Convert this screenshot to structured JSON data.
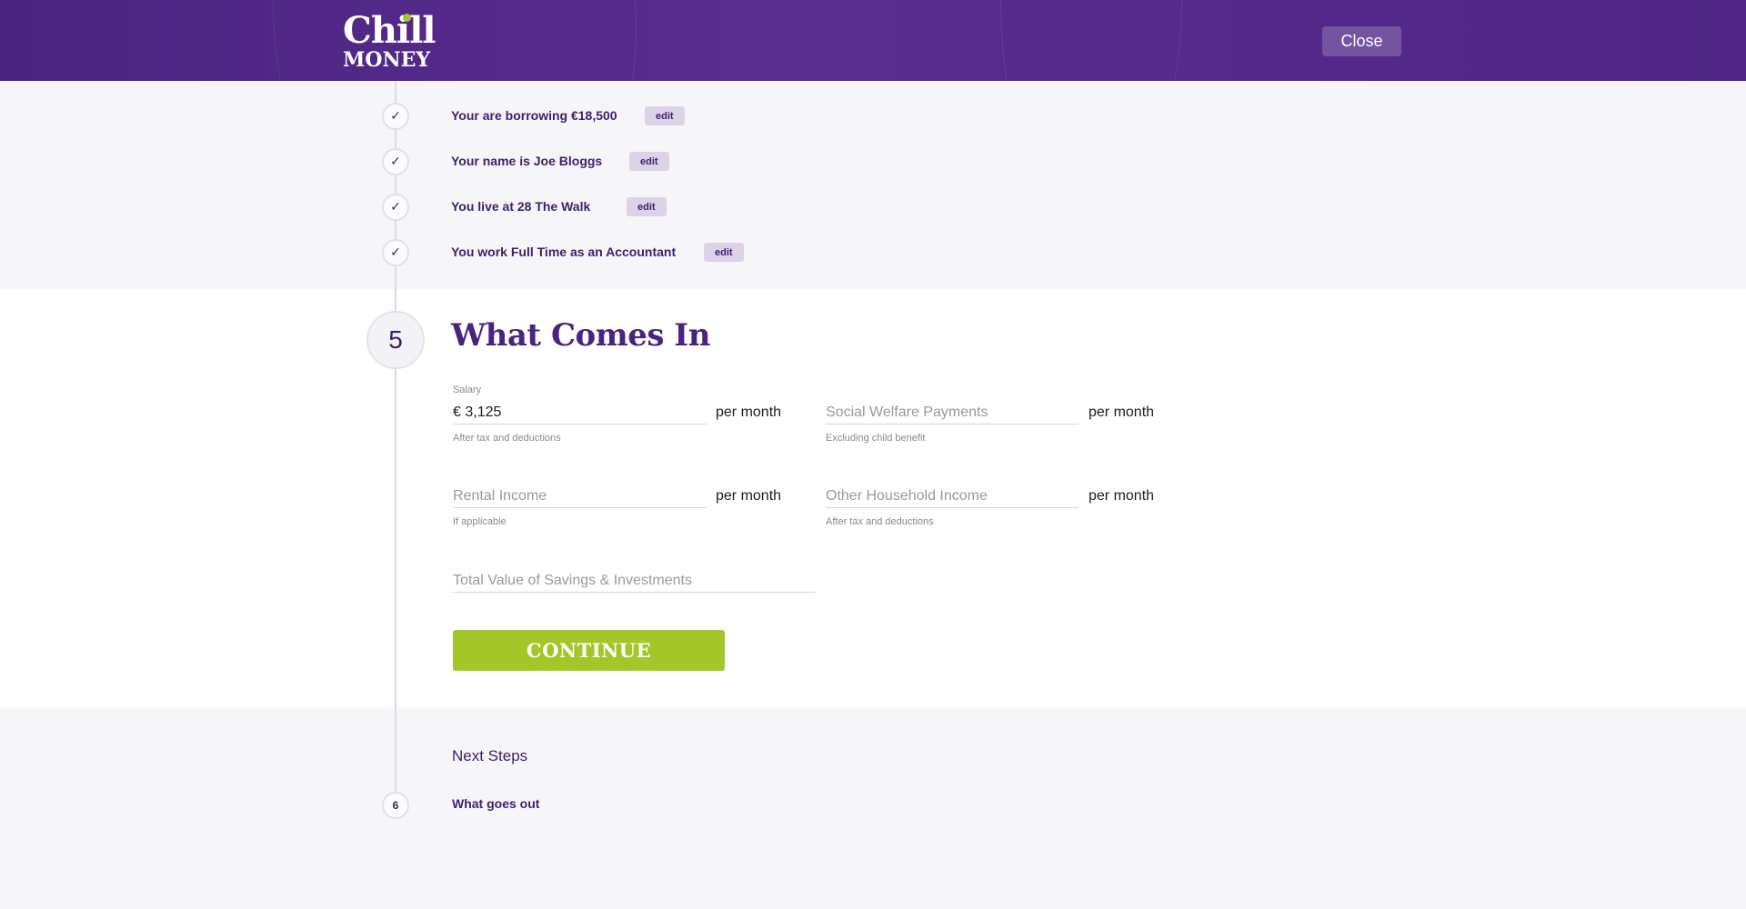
{
  "header": {
    "logo_line1": "Chill",
    "logo_line2": "MONEY",
    "close_label": "Close"
  },
  "completed_steps": [
    {
      "text": "Your are borrowing €18,500",
      "edit_label": "edit"
    },
    {
      "text": "Your name is Joe Bloggs",
      "edit_label": "edit"
    },
    {
      "text": "You live at 28 The Walk",
      "edit_label": "edit"
    },
    {
      "text": "You work Full Time as an Accountant",
      "edit_label": "edit"
    }
  ],
  "active_step": {
    "number": "5",
    "title": "What Comes In",
    "fields": {
      "salary": {
        "label": "Salary",
        "value": "€ 3,125",
        "help": "After tax and deductions",
        "suffix": "per month"
      },
      "social_welfare": {
        "placeholder": "Social Welfare Payments",
        "help": "Excluding child benefit",
        "suffix": "per month"
      },
      "rental_income": {
        "placeholder": "Rental Income",
        "help": "If applicable",
        "suffix": "per month"
      },
      "other_income": {
        "placeholder": "Other Household Income",
        "help": "After tax and deductions",
        "suffix": "per month"
      },
      "savings": {
        "placeholder": "Total Value of Savings & Investments"
      }
    },
    "continue_label": "CONTINUE"
  },
  "next_steps": {
    "heading": "Next Steps",
    "items": [
      {
        "number": "6",
        "label": "What goes out"
      }
    ]
  },
  "colors": {
    "brand_purple": "#4a2380",
    "accent_green": "#a5c628",
    "edit_badge": "#dcd3e8"
  }
}
